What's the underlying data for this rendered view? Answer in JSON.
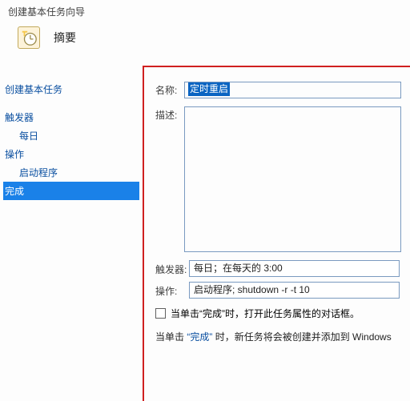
{
  "wizard_title": "创建基本任务向导",
  "summary_label": "摘要",
  "sidebar": {
    "top": "创建基本任务",
    "trigger_label": "触发器",
    "trigger_sub": "每日",
    "action_label": "操作",
    "action_sub": "启动程序",
    "finish_label": "完成"
  },
  "form": {
    "name_label": "名称:",
    "name_value": "定时重启",
    "desc_label": "描述:",
    "desc_value": ""
  },
  "summary": {
    "trigger_label": "触发器:",
    "trigger_value": "每日；在每天的 3:00",
    "action_label": "操作:",
    "action_value": "启动程序; shutdown -r -t 10"
  },
  "open_props_label": "当单击“完成”时，打开此任务属性的对话框。",
  "info_prefix": "当单击",
  "info_finish_quoted": "“完成”",
  "info_suffix": "时，新任务将会被创建并添加到 Windows"
}
